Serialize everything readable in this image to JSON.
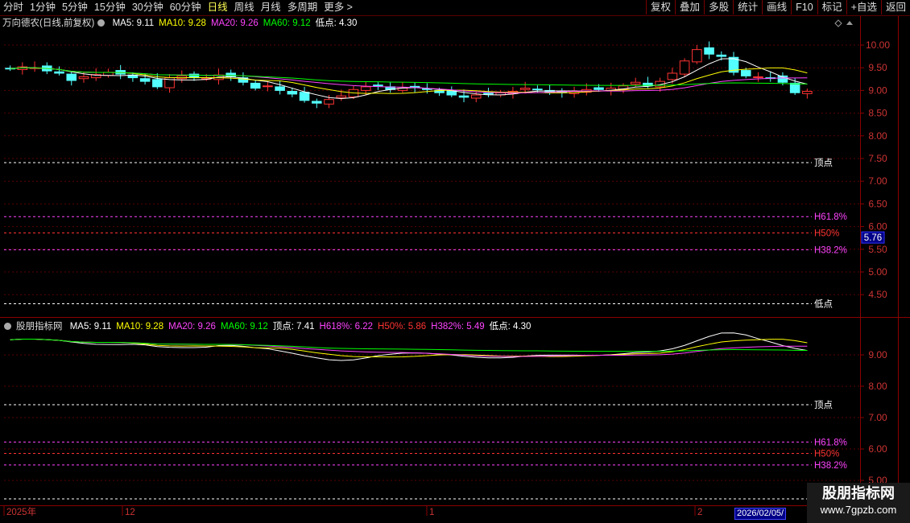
{
  "toolbar": {
    "periods": [
      "分时",
      "1分钟",
      "5分钟",
      "15分钟",
      "30分钟",
      "60分钟",
      "日线",
      "周线",
      "月线",
      "多周期",
      "更多 >"
    ],
    "active_period": "日线",
    "actions": [
      "复权",
      "叠加",
      "多股",
      "统计",
      "画线",
      "F10",
      "标记",
      "+自选",
      "返回"
    ]
  },
  "main_panel": {
    "title": "万向德农(日线,前复权)",
    "ma": [
      {
        "label": "MA5: 9.11",
        "color": "#ffffff"
      },
      {
        "label": "MA10: 9.28",
        "color": "#ffff00"
      },
      {
        "label": "MA20: 9.26",
        "color": "#ff44ff"
      },
      {
        "label": "MA60: 9.12",
        "color": "#00ff00"
      },
      {
        "label": "低点: 4.30",
        "color": "#ffffff"
      }
    ],
    "y_ticks": [
      "10.00",
      "9.50",
      "9.00",
      "8.50",
      "8.00",
      "7.50",
      "7.00",
      "6.50",
      "6.00",
      "5.50",
      "5.00",
      "4.50"
    ],
    "levels": [
      {
        "label": "顶点",
        "color": "#ffffff",
        "value": 7.41
      },
      {
        "label": "H61.8%",
        "color": "#ff44ff",
        "value": 6.22
      },
      {
        "label": "H50%",
        "color": "#ff3333",
        "value": 5.86
      },
      {
        "label": "H38.2%",
        "color": "#ff44ff",
        "value": 5.49
      },
      {
        "label": "低点",
        "color": "#ffffff",
        "value": 4.3
      }
    ],
    "price_tag": "5.76"
  },
  "indicator_panel": {
    "title": "股朋指标网",
    "values": [
      {
        "label": "MA5: 9.11",
        "color": "#ffffff"
      },
      {
        "label": "MA10: 9.28",
        "color": "#ffff00"
      },
      {
        "label": "MA20: 9.26",
        "color": "#ff44ff"
      },
      {
        "label": "MA60: 9.12",
        "color": "#00ff00"
      },
      {
        "label": "顶点: 7.41",
        "color": "#ffffff"
      },
      {
        "label": "H618%: 6.22",
        "color": "#ff44ff"
      },
      {
        "label": "H50%: 5.86",
        "color": "#ff3333"
      },
      {
        "label": "H382%: 5.49",
        "color": "#ff44ff"
      },
      {
        "label": "低点: 4.30",
        "color": "#ffffff"
      }
    ],
    "y_ticks": [
      "9.00",
      "8.00",
      "7.00",
      "6.00",
      "5.00"
    ],
    "levels": [
      {
        "label": "顶点",
        "color": "#ffffff",
        "value": 7.41
      },
      {
        "label": "H61.8%",
        "color": "#ff44ff",
        "value": 6.22
      },
      {
        "label": "H50%",
        "color": "#ff3333",
        "value": 5.86
      },
      {
        "label": "H38.2%",
        "color": "#ff44ff",
        "value": 5.49
      }
    ]
  },
  "x_axis": {
    "labels": [
      "2025年",
      "12",
      "1",
      "2"
    ],
    "cursor_date": "2026/02/05/"
  },
  "watermark": {
    "name": "股朋指标网",
    "url": "www.7gpzb.com"
  },
  "chart_data": {
    "type": "candlestick",
    "ma_series": [
      "MA5",
      "MA10",
      "MA20",
      "MA60"
    ],
    "closes": [
      9.48,
      9.52,
      9.5,
      9.43,
      9.38,
      9.22,
      9.3,
      9.35,
      9.4,
      9.36,
      9.28,
      9.2,
      9.08,
      9.28,
      9.32,
      9.28,
      9.26,
      9.34,
      9.3,
      9.18,
      9.05,
      9.1,
      9.0,
      8.92,
      8.78,
      8.72,
      8.8,
      8.88,
      9.02,
      9.08,
      9.1,
      9.02,
      9.05,
      9.06,
      9.02,
      8.95,
      8.9,
      8.85,
      8.9,
      8.92,
      8.95,
      8.98,
      9.05,
      9.02,
      8.95,
      8.95,
      8.98,
      9.02,
      9.02,
      9.05,
      9.1,
      9.18,
      9.1,
      9.2,
      9.38,
      9.65,
      9.9,
      9.8,
      9.75,
      9.4,
      9.32,
      9.3,
      9.28,
      9.18,
      8.95,
      8.98
    ],
    "ylim": [
      4.3,
      10.35
    ]
  }
}
